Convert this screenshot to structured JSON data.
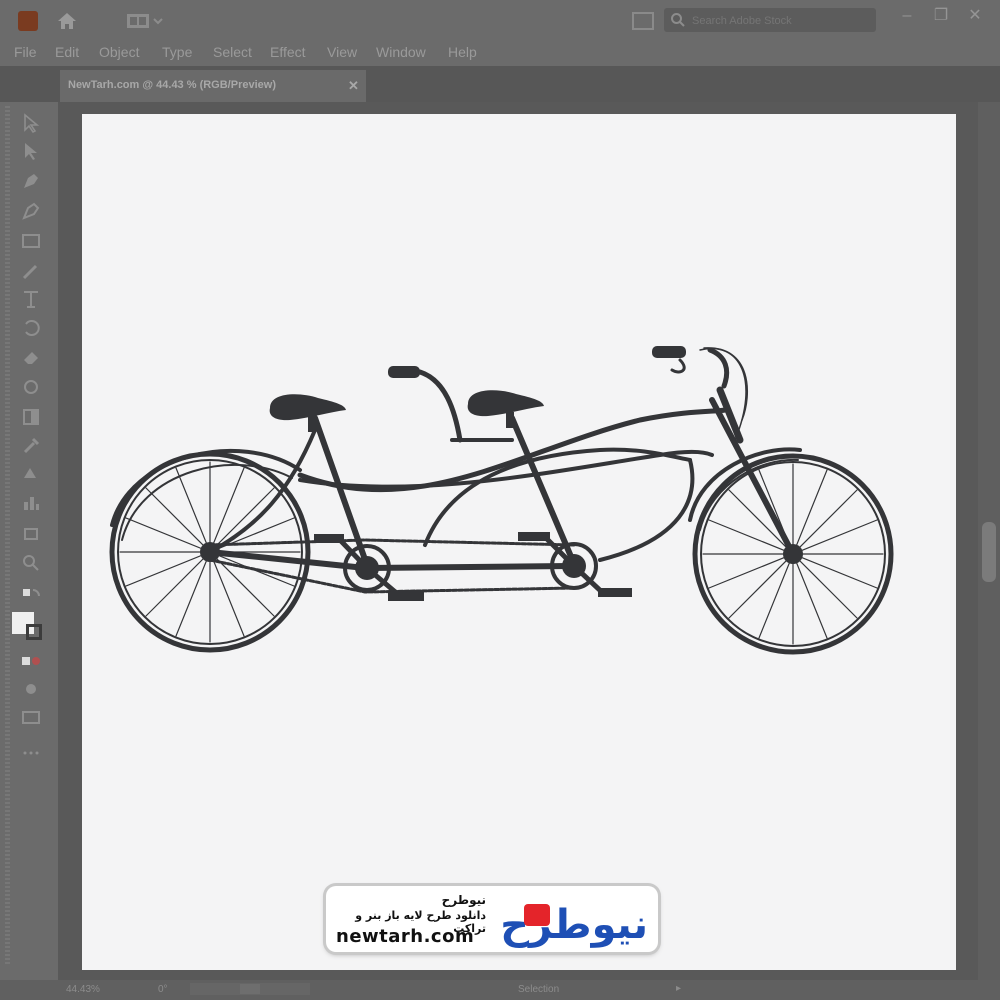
{
  "window": {
    "search_placeholder": "Search Adobe Stock"
  },
  "menu": [
    "File",
    "Edit",
    "Object",
    "Type",
    "Select",
    "Effect",
    "View",
    "Window",
    "Help"
  ],
  "document_tab": {
    "title": "NewTarh.com @ 44.43 % (RGB/Preview)",
    "close": "✕"
  },
  "statusbar": {
    "zoom": "44.43%",
    "rotation": "0°",
    "tool": "Selection"
  },
  "watermark": {
    "logo_text": "نیوطرح",
    "line1": "نیوطرح",
    "line2": "دانلود طرح لایه باز بنر و تراکت",
    "url": "newtarh.com",
    "colors": {
      "blue": "#1e4fb5",
      "red": "#e4242a",
      "text": "#111111"
    }
  },
  "colors": {
    "artboard": "#f4f4f5",
    "chrome": "#6b6b6b",
    "bike": "#343538"
  }
}
